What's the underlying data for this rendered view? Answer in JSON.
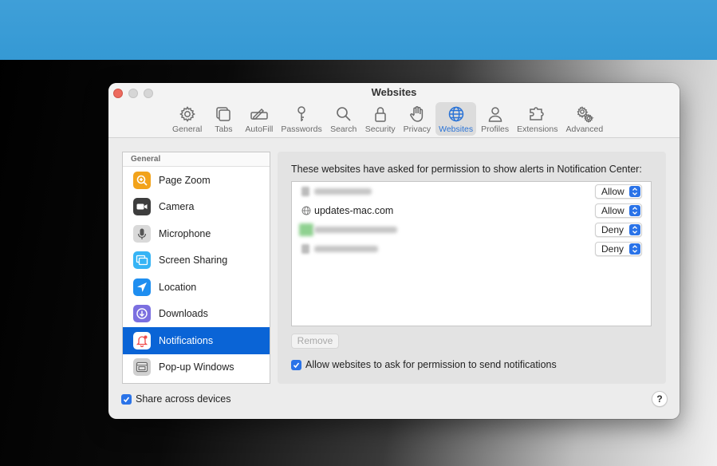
{
  "window": {
    "title": "Websites"
  },
  "toolbar": {
    "tabs": [
      {
        "label": "General",
        "icon": "gear-icon"
      },
      {
        "label": "Tabs",
        "icon": "tabs-icon"
      },
      {
        "label": "AutoFill",
        "icon": "autofill-icon"
      },
      {
        "label": "Passwords",
        "icon": "key-icon"
      },
      {
        "label": "Search",
        "icon": "magnifier-icon"
      },
      {
        "label": "Security",
        "icon": "lock-icon"
      },
      {
        "label": "Privacy",
        "icon": "hand-icon"
      },
      {
        "label": "Websites",
        "icon": "globe-icon",
        "active": true
      },
      {
        "label": "Profiles",
        "icon": "person-icon"
      },
      {
        "label": "Extensions",
        "icon": "puzzle-icon"
      },
      {
        "label": "Advanced",
        "icon": "gears-icon"
      }
    ]
  },
  "sidebar": {
    "header": "General",
    "items": [
      {
        "label": "Page Zoom",
        "icon": "zoom-icon",
        "color": "#f2a31b"
      },
      {
        "label": "Camera",
        "icon": "camera-icon",
        "color": "#3d3d3d"
      },
      {
        "label": "Microphone",
        "icon": "microphone-icon",
        "color": "#d9d9d9"
      },
      {
        "label": "Screen Sharing",
        "icon": "screen-sharing-icon",
        "color": "#36b4f5"
      },
      {
        "label": "Location",
        "icon": "location-icon",
        "color": "#1e8ef0"
      },
      {
        "label": "Downloads",
        "icon": "downloads-icon",
        "color": "#7b6fe0"
      },
      {
        "label": "Notifications",
        "icon": "notifications-icon",
        "color": "#f04a4a",
        "selected": true
      },
      {
        "label": "Pop-up Windows",
        "icon": "popup-windows-icon",
        "color": "#d0d0d0"
      }
    ]
  },
  "panel": {
    "description": "These websites have asked for permission to show alerts in Notification Center:",
    "sites": [
      {
        "name": "",
        "blurred": true,
        "permission": "Allow"
      },
      {
        "name": "updates-mac.com",
        "blurred": false,
        "permission": "Allow"
      },
      {
        "name": "",
        "blurred": true,
        "permission": "Deny"
      },
      {
        "name": "",
        "blurred": true,
        "permission": "Deny"
      }
    ],
    "remove_label": "Remove",
    "allow_ask_label": "Allow websites to ask for permission to send notifications",
    "allow_ask_checked": true
  },
  "footer": {
    "share_label": "Share across devices",
    "share_checked": true,
    "help_label": "?"
  },
  "colors": {
    "accent": "#2a73e8",
    "selection": "#0a64d6"
  }
}
